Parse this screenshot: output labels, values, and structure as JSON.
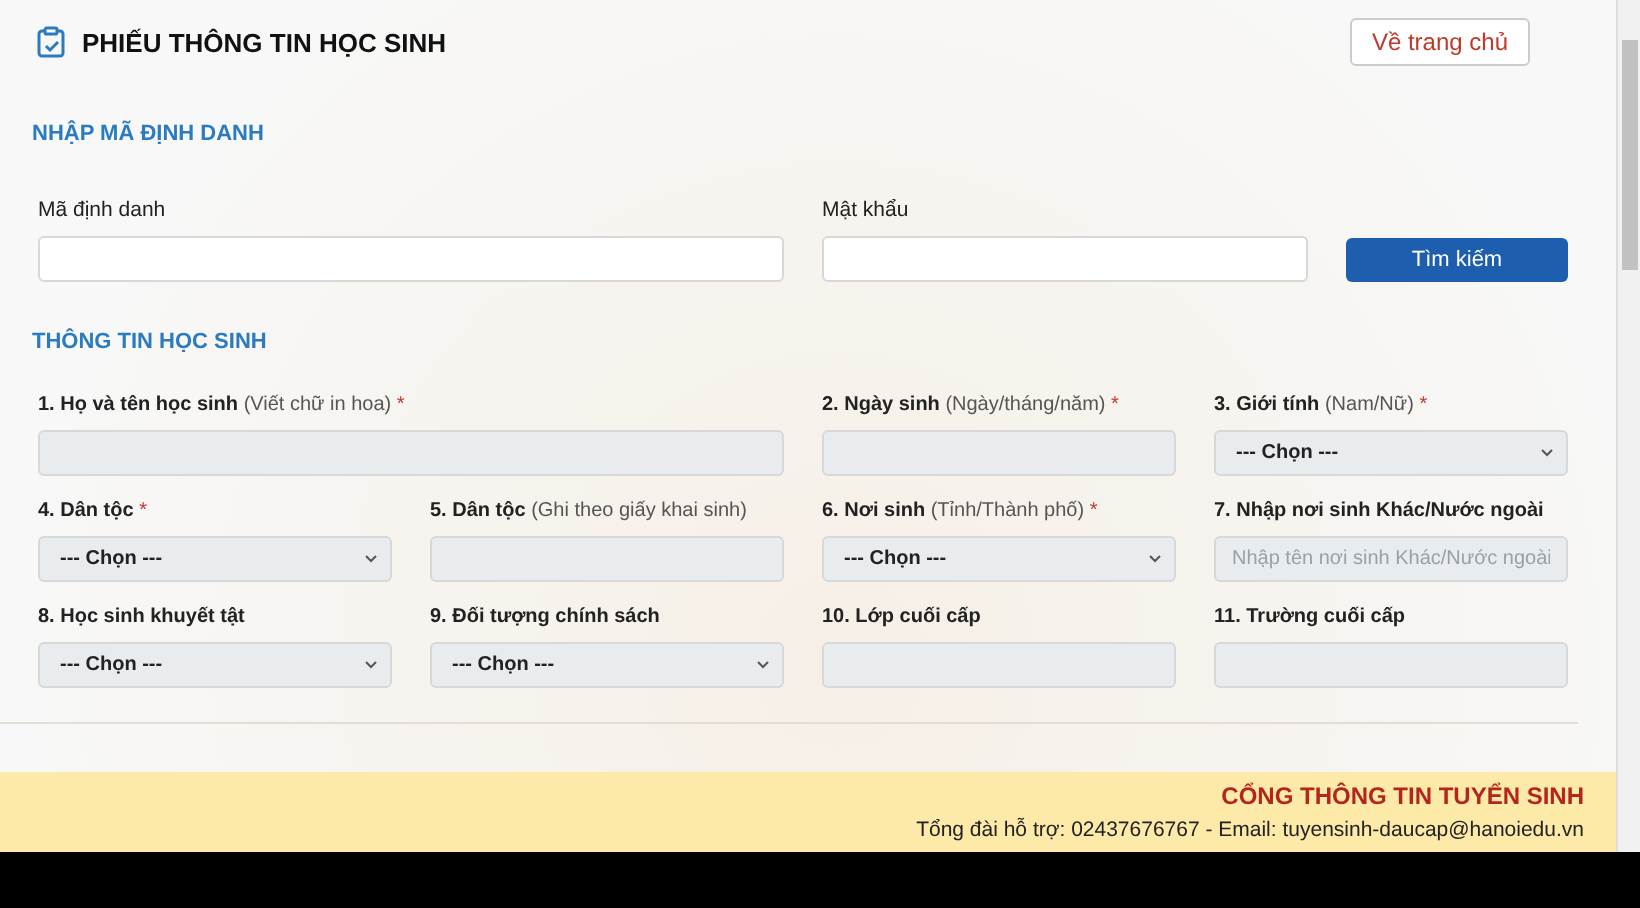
{
  "header": {
    "title": "PHIẾU THÔNG TIN HỌC SINH",
    "home_button": "Về trang chủ"
  },
  "lookup": {
    "title": "NHẬP MÃ ĐỊNH DANH",
    "fields": [
      {
        "label": "Mã định danh",
        "kind": "input"
      },
      {
        "label": "Mật khẩu",
        "kind": "input"
      }
    ],
    "search_button": "Tìm kiếm"
  },
  "student": {
    "title": "THÔNG TIN HỌC SINH",
    "fields": [
      {
        "label": "1. Họ và tên học sinh",
        "hint": "(Viết chữ in hoa)",
        "required_mark": "*",
        "kind": "input",
        "wide": true
      },
      {
        "label": "2. Ngày sinh",
        "hint": "(Ngày/tháng/năm)",
        "required_mark": "*",
        "kind": "input",
        "wide": false
      },
      {
        "label": "3. Giới tính",
        "hint": "(Nam/Nữ)",
        "required_mark": "*",
        "kind": "select",
        "value": "--- Chọn ---",
        "wide": false
      },
      {
        "label": "4. Dân tộc",
        "required_mark": "*",
        "kind": "select",
        "value": "--- Chọn ---",
        "wide": false
      },
      {
        "label": "5. Dân tộc",
        "hint": "(Ghi theo giấy khai sinh)",
        "kind": "input",
        "wide": false
      },
      {
        "label": "6. Nơi sinh",
        "hint": "(Tỉnh/Thành phố)",
        "required_mark": "*",
        "kind": "select",
        "value": "--- Chọn ---",
        "wide": false
      },
      {
        "label": "7. Nhập nơi sinh Khác/Nước ngoài",
        "kind": "input",
        "placeholder": "Nhập tên nơi sinh Khác/Nước ngoài",
        "wide": false
      },
      {
        "label": "8. Học sinh khuyết tật",
        "kind": "select",
        "value": "--- Chọn ---",
        "wide": false
      },
      {
        "label": "9. Đối tượng chính sách",
        "kind": "select",
        "value": "--- Chọn ---",
        "wide": false
      },
      {
        "label": "10. Lớp cuối cấp",
        "kind": "input",
        "wide": false
      },
      {
        "label": "11. Trường cuối cấp",
        "kind": "input",
        "wide": false
      }
    ]
  },
  "footer": {
    "title": "CỔNG THÔNG TIN TUYỂN SINH",
    "contact": "Tổng đài hỗ trợ: 02437676767 - Email: tuyensinh-daucap@hanoiedu.vn"
  }
}
